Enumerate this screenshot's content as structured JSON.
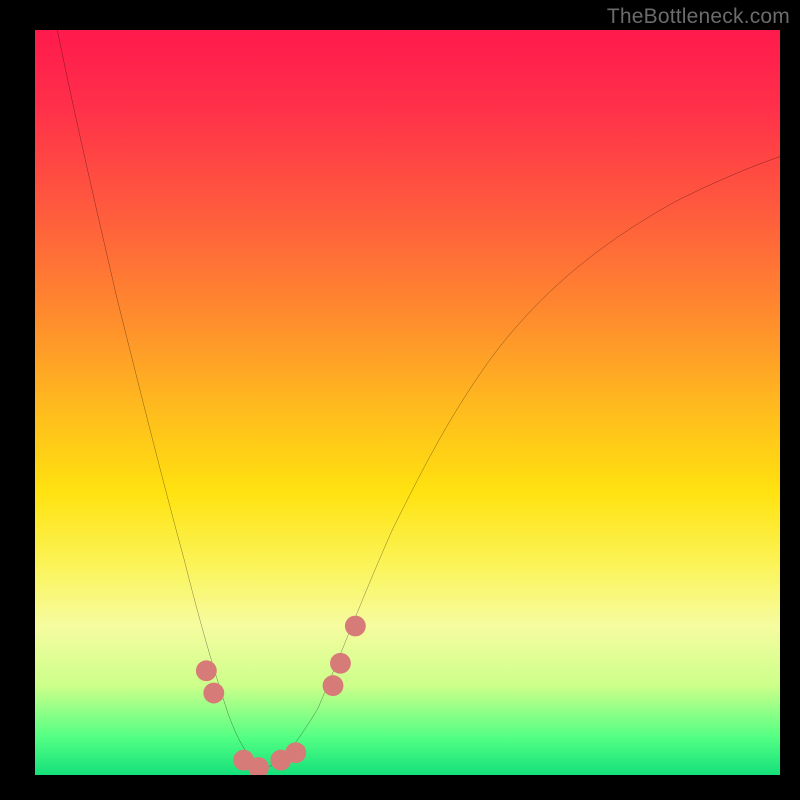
{
  "watermark": "TheBottleneck.com",
  "chart_data": {
    "type": "line",
    "title": "",
    "xlabel": "",
    "ylabel": "",
    "xlim": [
      0,
      100
    ],
    "ylim": [
      0,
      100
    ],
    "grid": false,
    "legend": "none",
    "background_gradient": {
      "orientation": "vertical",
      "stops": [
        {
          "pos": 0.0,
          "color": "#ff1a4d"
        },
        {
          "pos": 0.5,
          "color": "#ffe20f"
        },
        {
          "pos": 0.95,
          "color": "#52ff84"
        },
        {
          "pos": 1.0,
          "color": "#15e07a"
        }
      ]
    },
    "series": [
      {
        "name": "bottleneck-curve",
        "color": "#000000",
        "x": [
          3,
          5,
          8,
          11,
          14,
          17,
          20,
          23,
          25,
          27,
          29,
          31,
          33,
          36,
          40,
          44,
          48,
          54,
          60,
          68,
          76,
          85,
          94,
          100
        ],
        "y": [
          100,
          90,
          77,
          64,
          52,
          40,
          29,
          18,
          10,
          5,
          2,
          1,
          2,
          5,
          12,
          22,
          32,
          44,
          54,
          63,
          70,
          76,
          80,
          83
        ]
      }
    ],
    "markers": [
      {
        "name": "marker-left-upper",
        "x": 23,
        "y": 14,
        "color": "#d77b78"
      },
      {
        "name": "marker-left-lower",
        "x": 24,
        "y": 11,
        "color": "#d77b78"
      },
      {
        "name": "marker-bottom-1",
        "x": 28,
        "y": 2,
        "color": "#d77b78"
      },
      {
        "name": "marker-bottom-2",
        "x": 30,
        "y": 1,
        "color": "#d77b78"
      },
      {
        "name": "marker-bottom-3",
        "x": 33,
        "y": 2,
        "color": "#d77b78"
      },
      {
        "name": "marker-bottom-4",
        "x": 35,
        "y": 3,
        "color": "#d77b78"
      },
      {
        "name": "marker-right-lower",
        "x": 40,
        "y": 12,
        "color": "#d77b78"
      },
      {
        "name": "marker-right-mid",
        "x": 41,
        "y": 15,
        "color": "#d77b78"
      },
      {
        "name": "marker-right-upper",
        "x": 43,
        "y": 20,
        "color": "#d77b78"
      }
    ]
  }
}
